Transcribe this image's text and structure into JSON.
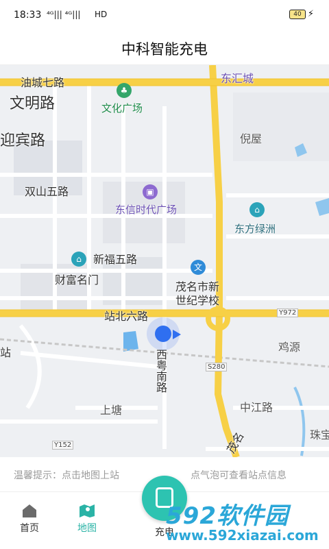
{
  "status_bar": {
    "time": "18:33",
    "signal": "⁴ᴳ|||  ⁴ᴳ|||",
    "network": "HD",
    "battery": "40"
  },
  "header": {
    "title": "中科智能充电"
  },
  "map": {
    "labels": {
      "youcheng": "油城七路",
      "donghuicheng": "东汇城",
      "wenming": "文明路",
      "wenhua": "文化广场",
      "yingbin": "迎宾路",
      "niwu": "倪屋",
      "shuangshan": "双山五路",
      "dongxin": "东信时代广场",
      "dongfang": "东方绿洲",
      "xinfu": "新福五路",
      "caifu": "财富名门",
      "maoming": "茂名市新",
      "shiji": "世纪学校",
      "zhanbei": "站北六路",
      "xiyue": "西粤南路",
      "y972": "Y972",
      "jiyuan": "鸡源",
      "s280": "S280",
      "shangtang": "上塘",
      "zhongjiang": "中江路",
      "y152": "Y152",
      "zhubao": "珠宝",
      "zhan": "站",
      "mao": "茂名"
    }
  },
  "tip": {
    "left": "温馨提示：点击地图上站",
    "right": "点气泡可查看站点信息"
  },
  "tabs": {
    "home": "首页",
    "map": "地图",
    "charge": "充电"
  },
  "watermark": {
    "logo": "592软件园",
    "url": "www.592xiazai.com"
  },
  "colors": {
    "accent": "#2ab3a6",
    "road": "#f7d046",
    "location": "#2f6ff0"
  }
}
